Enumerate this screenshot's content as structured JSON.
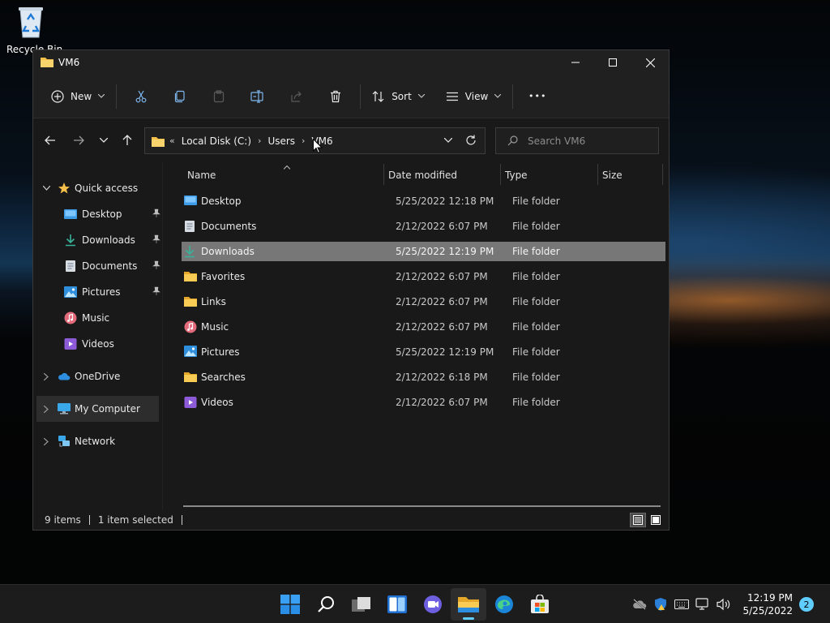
{
  "desktop": {
    "recycle_bin_label": "Recycle Bin"
  },
  "window": {
    "title": "VM6",
    "controls": [
      "minimize",
      "maximize",
      "close"
    ]
  },
  "toolbar": {
    "new_label": "New",
    "sort_label": "Sort",
    "view_label": "View",
    "more_label": "•••"
  },
  "address": {
    "overflow": "«",
    "crumbs": [
      "Local Disk (C:)",
      "Users",
      "VM6"
    ]
  },
  "search": {
    "placeholder": "Search VM6"
  },
  "sidebar": {
    "quick_access": "Quick access",
    "items": [
      {
        "label": "Desktop",
        "pinned": true
      },
      {
        "label": "Downloads",
        "pinned": true
      },
      {
        "label": "Documents",
        "pinned": true
      },
      {
        "label": "Pictures",
        "pinned": true
      },
      {
        "label": "Music",
        "pinned": false
      },
      {
        "label": "Videos",
        "pinned": false
      }
    ],
    "onedrive": "OneDrive",
    "my_computer": "My Computer",
    "network": "Network"
  },
  "columns": {
    "name": "Name",
    "date": "Date modified",
    "type": "Type",
    "size": "Size"
  },
  "files": [
    {
      "name": "Desktop",
      "date": "5/25/2022 12:18 PM",
      "type": "File folder",
      "icon": "desktop-folder"
    },
    {
      "name": "Documents",
      "date": "2/12/2022 6:07 PM",
      "type": "File folder",
      "icon": "documents-folder"
    },
    {
      "name": "Downloads",
      "date": "5/25/2022 12:19 PM",
      "type": "File folder",
      "icon": "downloads-folder",
      "selected": true
    },
    {
      "name": "Favorites",
      "date": "2/12/2022 6:07 PM",
      "type": "File folder",
      "icon": "folder"
    },
    {
      "name": "Links",
      "date": "2/12/2022 6:07 PM",
      "type": "File folder",
      "icon": "folder"
    },
    {
      "name": "Music",
      "date": "2/12/2022 6:07 PM",
      "type": "File folder",
      "icon": "music-folder"
    },
    {
      "name": "Pictures",
      "date": "5/25/2022 12:19 PM",
      "type": "File folder",
      "icon": "pictures-folder"
    },
    {
      "name": "Searches",
      "date": "2/12/2022 6:18 PM",
      "type": "File folder",
      "icon": "folder"
    },
    {
      "name": "Videos",
      "date": "2/12/2022 6:07 PM",
      "type": "File folder",
      "icon": "videos-folder"
    }
  ],
  "status": {
    "count": "9 items",
    "selected": "1 item selected"
  },
  "taskbar": {
    "time": "12:19 PM",
    "date": "5/25/2022",
    "notifications": "2"
  },
  "colors": {
    "accent": "#60cdff",
    "selection": "#777777",
    "folder": "#f5c04a"
  }
}
